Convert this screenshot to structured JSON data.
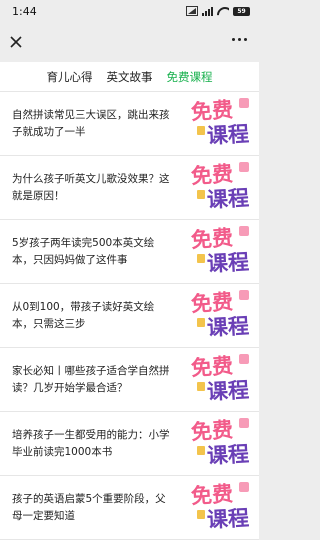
{
  "status_bar": {
    "time": "1:44",
    "battery": "59"
  },
  "header": {
    "close_icon": "close-icon",
    "more_icon": "more-icon"
  },
  "tabs": [
    {
      "label": "育儿心得",
      "active": false
    },
    {
      "label": "英文故事",
      "active": false
    },
    {
      "label": "免费课程",
      "active": true
    }
  ],
  "colors": {
    "accent": "#16b04c",
    "badge_pink": "#f25b8a",
    "badge_purple": "#6a3fb6"
  },
  "badge": {
    "line1": "免费",
    "line2": "课程"
  },
  "articles": [
    {
      "title": "自然拼读常见三大误区，跳出来孩子就成功了一半"
    },
    {
      "title": "为什么孩子听英文儿歌没效果？这就是原因！"
    },
    {
      "title": "5岁孩子两年读完500本英文绘本，只因妈妈做了这件事"
    },
    {
      "title": "从0到100，带孩子读好英文绘本，只需这三步"
    },
    {
      "title": "家长必知丨哪些孩子适合学自然拼读？几岁开始学最合适？"
    },
    {
      "title": "培养孩子一生都受用的能力：小学毕业前读完1000本书"
    },
    {
      "title": "孩子的英语启蒙5个重要阶段，父母一定要知道"
    }
  ]
}
